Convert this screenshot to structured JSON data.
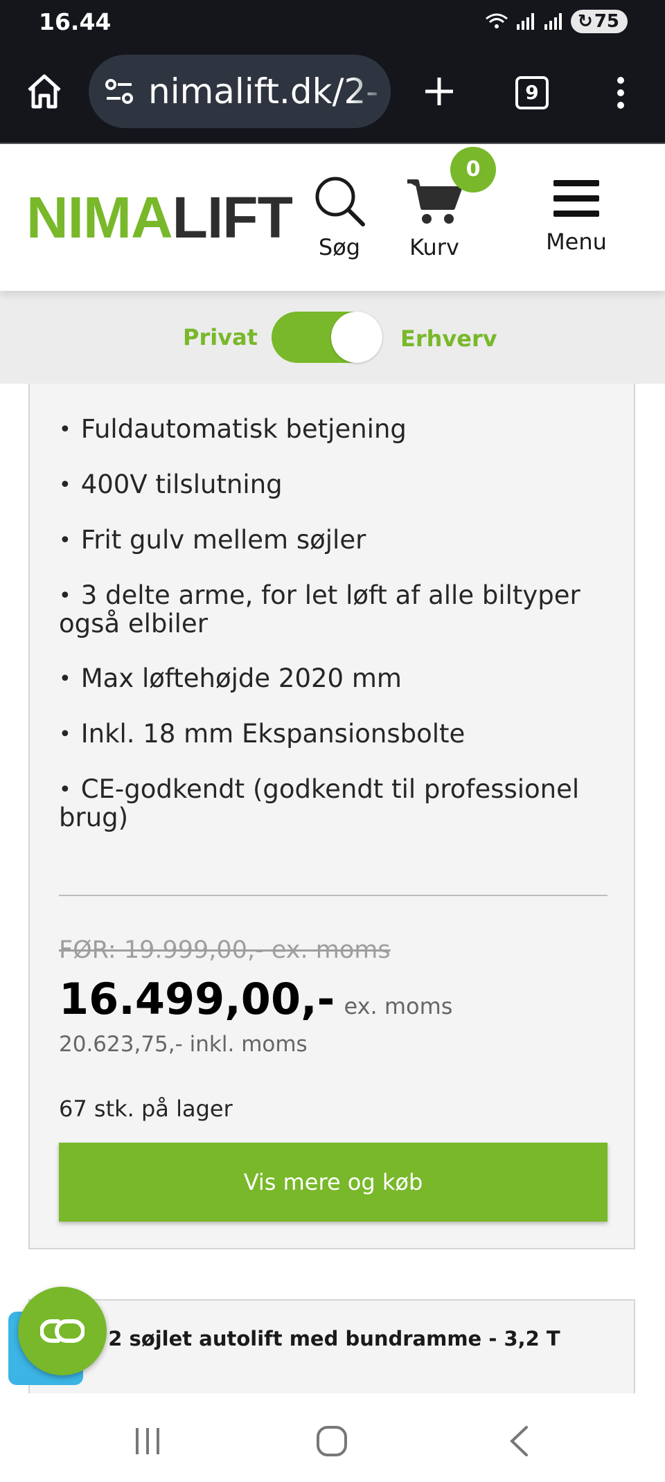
{
  "status_bar": {
    "time": "16.44",
    "battery": "75"
  },
  "browser": {
    "url": "nimalift.dk/2-",
    "tab_count": "9"
  },
  "header": {
    "logo_part1": "NIMA",
    "logo_part2": "LIFT",
    "search_label": "Søg",
    "cart_label": "Kurv",
    "cart_count": "0",
    "menu_label": "Menu"
  },
  "toggle": {
    "left_label": "Privat",
    "right_label": "Erhverv"
  },
  "product": {
    "features": [
      "Fuldautomatisk betjening",
      "400V tilslutning",
      "Frit gulv mellem søjler",
      "3 delte arme, for let løft af alle biltyper også elbiler",
      "Max løftehøjde 2020 mm",
      "Inkl. 18 mm Ekspansionsbolte",
      "CE-godkendt (godkendt til professionel brug)"
    ],
    "old_price": "FØR: 19.999,00,- ex. moms",
    "price": "16.499,00,-",
    "price_suffix": "ex. moms",
    "price_incl": "20.623,75,- inkl. moms",
    "stock": "67 stk. på lager",
    "buy_label": "Vis mere og køb"
  },
  "next_product": {
    "title": "os 2 søjlet autolift med bundramme - 3,2 T"
  },
  "colors": {
    "brand_green": "#78b82a",
    "dark": "#14161c",
    "chat_blue": "#3cb4e5"
  }
}
